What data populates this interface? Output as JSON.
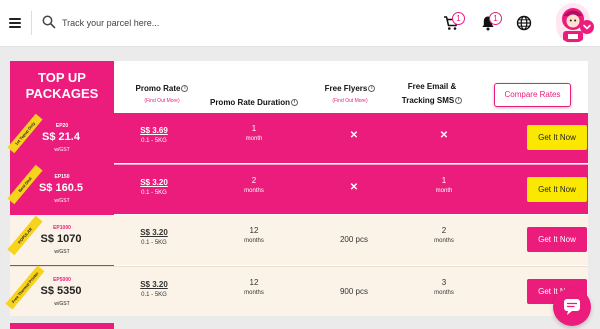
{
  "header": {
    "search_placeholder": "Track your parcel here...",
    "cart_count": "1",
    "notifications_count": "1"
  },
  "packages": {
    "title": "TOP UP PACKAGES",
    "columns": {
      "promo_rate": "Promo Rate",
      "promo_rate_link": "(Find Out More)",
      "duration": "Promo Rate Duration",
      "free_flyers": "Free Flyers",
      "free_flyers_link": "(Find Out More)",
      "email_sms": "Free Email & Tracking SMS"
    },
    "compare_label": "Compare Rates",
    "rows": [
      {
        "ribbon": "1st Topup Only",
        "code": "EP20",
        "price": "S$ 21.4",
        "gst": "w/GST",
        "rate": "S$ 3.69",
        "weight": "0.1 - 5KG",
        "duration": "1",
        "duration_unit": "month",
        "flyers": "✕",
        "sms": "✕",
        "sms_unit": "",
        "button": "Get It Now",
        "theme": "pink"
      },
      {
        "ribbon": "Best Deal",
        "code": "EP150",
        "price": "S$ 160.5",
        "gst": "w/GST",
        "rate": "S$ 3.20",
        "weight": "0.1 - 5KG",
        "duration": "2",
        "duration_unit": "months",
        "flyers": "✕",
        "sms": "1",
        "sms_unit": "month",
        "button": "Get It Now",
        "theme": "pink"
      },
      {
        "ribbon": "POPULAR",
        "code": "EP1000",
        "price": "S$ 1070",
        "gst": "w/GST",
        "rate": "S$ 3.20",
        "weight": "0.1 - 5KG",
        "duration": "12",
        "duration_unit": "months",
        "flyers": "200 pcs",
        "sms": "2",
        "sms_unit": "months",
        "button": "Get It Now",
        "theme": "cream"
      },
      {
        "ribbon": "Free Thermal Printer",
        "code": "EP5000",
        "price": "S$ 5350",
        "gst": "w/GST",
        "rate": "S$ 3.20",
        "weight": "0.1 - 5KG",
        "duration": "12",
        "duration_unit": "months",
        "flyers": "900 pcs",
        "sms": "3",
        "sms_unit": "months",
        "button": "Get It Now",
        "theme": "cream"
      }
    ]
  },
  "colors": {
    "brand_pink": "#ec1c7d",
    "cta_yellow": "#fbe800",
    "cream": "#fbf3e8",
    "ribbon_yellow": "#f7d31b"
  },
  "icons": [
    "menu-icon",
    "search-icon",
    "cart-icon",
    "bell-icon",
    "globe-icon",
    "chevron-down-icon",
    "chat-icon",
    "info-icon"
  ]
}
